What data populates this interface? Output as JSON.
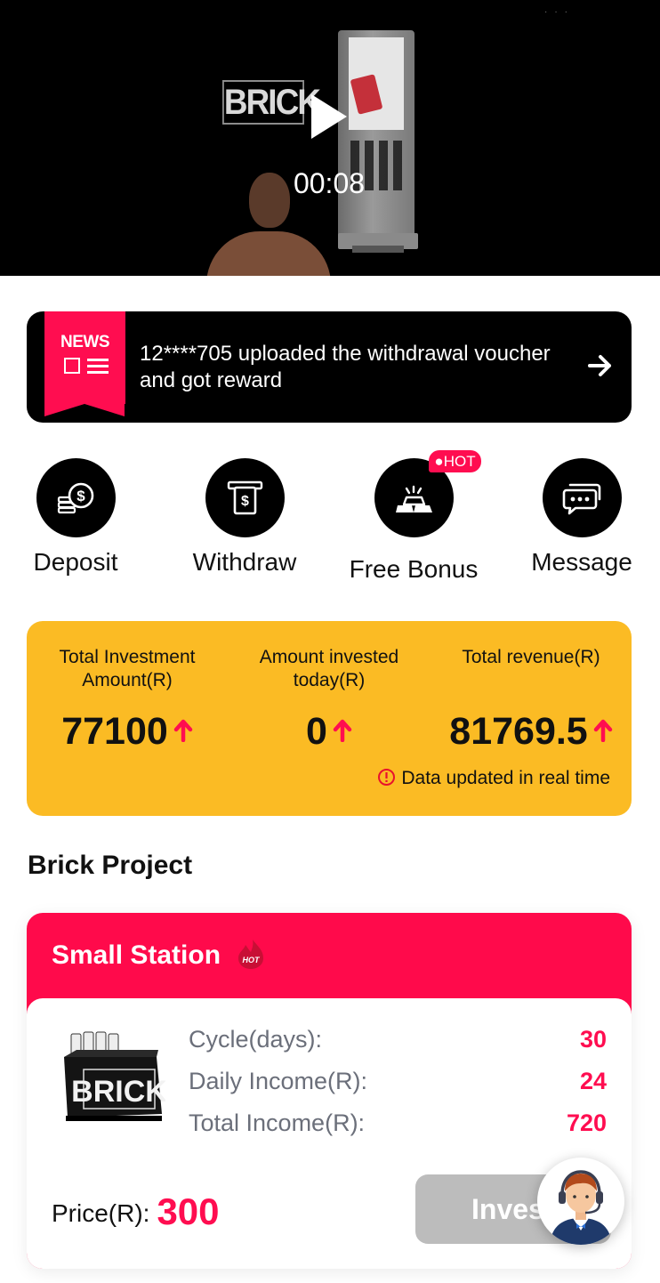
{
  "video": {
    "logo_text": "BRICK",
    "time": "00:08",
    "play_icon": "play-icon"
  },
  "news": {
    "badge": "NEWS",
    "text": "12****705 uploaded the withdrawal voucher and got reward",
    "arrow_icon": "arrow-right-icon"
  },
  "actions": [
    {
      "label": "Deposit",
      "icon": "coins-dollar-icon"
    },
    {
      "label": "Withdraw",
      "icon": "atm-withdraw-icon"
    },
    {
      "label": "Free Bonus",
      "icon": "gold-bars-icon",
      "badge": "HOT"
    },
    {
      "label": "Message",
      "icon": "chat-message-icon"
    }
  ],
  "stats": {
    "items": [
      {
        "title": "Total Investment Amount(R)",
        "value": "77100"
      },
      {
        "title": "Amount invested today(R)",
        "value": "0"
      },
      {
        "title": "Total revenue(R)",
        "value": "81769.5"
      }
    ],
    "note": "Data updated in real time",
    "up_icon": "arrow-up-icon",
    "info_icon": "info-circle-icon"
  },
  "section_title": "Brick Project",
  "project": {
    "name": "Small Station",
    "hot_label": "HOT",
    "rows": [
      {
        "label": "Cycle(days):",
        "value": "30"
      },
      {
        "label": "Daily Income(R):",
        "value": "24"
      },
      {
        "label": "Total Income(R):",
        "value": "720"
      }
    ],
    "price_label": "Price(R):",
    "price": "300",
    "button": "Invest",
    "product_logo": "BRICK"
  },
  "support_icon": "customer-service-agent-icon",
  "colors": {
    "accent": "#ff0d50",
    "stats_bg": "#fbbb24",
    "button_disabled": "#bcbcbc",
    "dark": "#000000"
  }
}
